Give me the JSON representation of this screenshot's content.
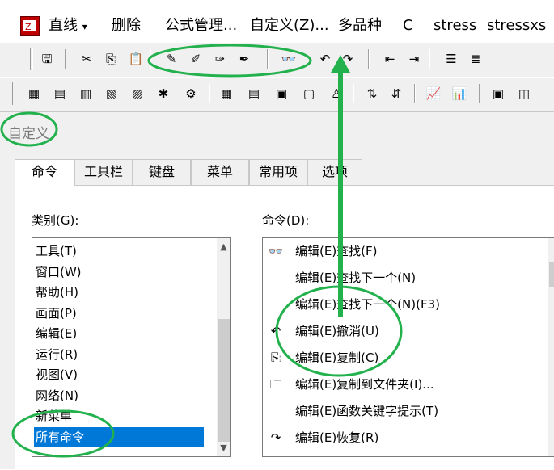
{
  "menubar": {
    "app_icon": "app-logo-icon",
    "items": [
      {
        "label": "直线",
        "dropdown": "▾"
      },
      {
        "label": "删除"
      },
      {
        "label": "公式管理..."
      },
      {
        "label": "自定义(Z)..."
      },
      {
        "label": "多品种"
      },
      {
        "label": "C"
      },
      {
        "label": "stress"
      },
      {
        "label": "stressxs"
      }
    ]
  },
  "toolbar1": {
    "buttons": [
      {
        "icon": "save-icon",
        "glyph": "🖫"
      },
      {
        "icon": "cut-icon",
        "glyph": "✂"
      },
      {
        "icon": "copy-icon",
        "glyph": "⎘"
      },
      {
        "icon": "paste-icon",
        "glyph": "📋"
      },
      {
        "icon": "draw-line-icon",
        "glyph": "✎"
      },
      {
        "icon": "edit-line-icon",
        "glyph": "✐"
      },
      {
        "icon": "move-line-icon",
        "glyph": "✑"
      },
      {
        "icon": "delete-line-icon",
        "glyph": "✒"
      },
      {
        "icon": "find-binoculars-icon",
        "glyph": "👓"
      },
      {
        "icon": "undo-icon",
        "glyph": "↶"
      },
      {
        "icon": "redo-icon",
        "glyph": "↷"
      },
      {
        "icon": "indent-decrease-icon",
        "glyph": "⇤"
      },
      {
        "icon": "indent-increase-icon",
        "glyph": "⇥"
      },
      {
        "icon": "comment-icon",
        "glyph": "☰"
      },
      {
        "icon": "uncomment-icon",
        "glyph": "≣"
      }
    ]
  },
  "toolbar2": {
    "buttons": [
      {
        "icon": "new-formula-icon",
        "glyph": "▦"
      },
      {
        "icon": "formula-2-icon",
        "glyph": "▤"
      },
      {
        "icon": "formula-3-icon",
        "glyph": "▥"
      },
      {
        "icon": "formula-4-icon",
        "glyph": "▧"
      },
      {
        "icon": "formula-5-icon",
        "glyph": "▨"
      },
      {
        "icon": "formula-6-icon",
        "glyph": "✱"
      },
      {
        "icon": "formula-7-icon",
        "glyph": "⚙"
      },
      {
        "icon": "grid-view-icon",
        "glyph": "▦"
      },
      {
        "icon": "list-view-icon",
        "glyph": "▤"
      },
      {
        "icon": "form-view-icon",
        "glyph": "▣"
      },
      {
        "icon": "window-view-icon",
        "glyph": "▢"
      },
      {
        "icon": "person-icon",
        "glyph": "♙"
      },
      {
        "icon": "sort-ascending-icon",
        "glyph": "⇅"
      },
      {
        "icon": "sort-descending-icon",
        "glyph": "⇵"
      },
      {
        "icon": "line-chart-icon",
        "glyph": "📈"
      },
      {
        "icon": "bar-chart-icon",
        "glyph": "📊"
      },
      {
        "icon": "window-1-icon",
        "glyph": "▣"
      },
      {
        "icon": "window-2-icon",
        "glyph": "◫"
      }
    ]
  },
  "dialog": {
    "title": "自定义",
    "tabs": [
      {
        "label": "命令",
        "active": true
      },
      {
        "label": "工具栏"
      },
      {
        "label": "键盘"
      },
      {
        "label": "菜单"
      },
      {
        "label": "常用项"
      },
      {
        "label": "选项"
      }
    ],
    "categories_label": "类别(G):",
    "categories": [
      "工具(T)",
      "窗口(W)",
      "帮助(H)",
      "画面(P)",
      "编辑(E)",
      "运行(R)",
      "视图(V)",
      "网络(N)",
      "新菜单",
      "所有命令"
    ],
    "categories_selected_index": 9,
    "commands_label": "命令(D):",
    "commands": [
      {
        "icon": "find-binoculars-icon",
        "glyph": "👓",
        "label": "编辑(E)查找(F)"
      },
      {
        "icon": "",
        "glyph": "",
        "label": "编辑(E)查找下一个(N)"
      },
      {
        "icon": "",
        "glyph": "",
        "label": "编辑(E)查找下一个(N)(F3)"
      },
      {
        "icon": "undo-icon",
        "glyph": "↶",
        "label": "编辑(E)撤消(U)"
      },
      {
        "icon": "copy-icon",
        "glyph": "⎘",
        "label": "编辑(E)复制(C)"
      },
      {
        "icon": "copy-to-folder-icon",
        "glyph": "🗀",
        "label": "编辑(E)复制到文件夹(I)..."
      },
      {
        "icon": "",
        "glyph": "",
        "label": "编辑(E)函数关键字提示(T)"
      },
      {
        "icon": "redo-icon",
        "glyph": "↷",
        "label": "编辑(E)恢复(R)"
      }
    ]
  },
  "colors": {
    "selection": "#0078d7",
    "annotation": "#22b14c",
    "face": "#f0f0f0"
  }
}
